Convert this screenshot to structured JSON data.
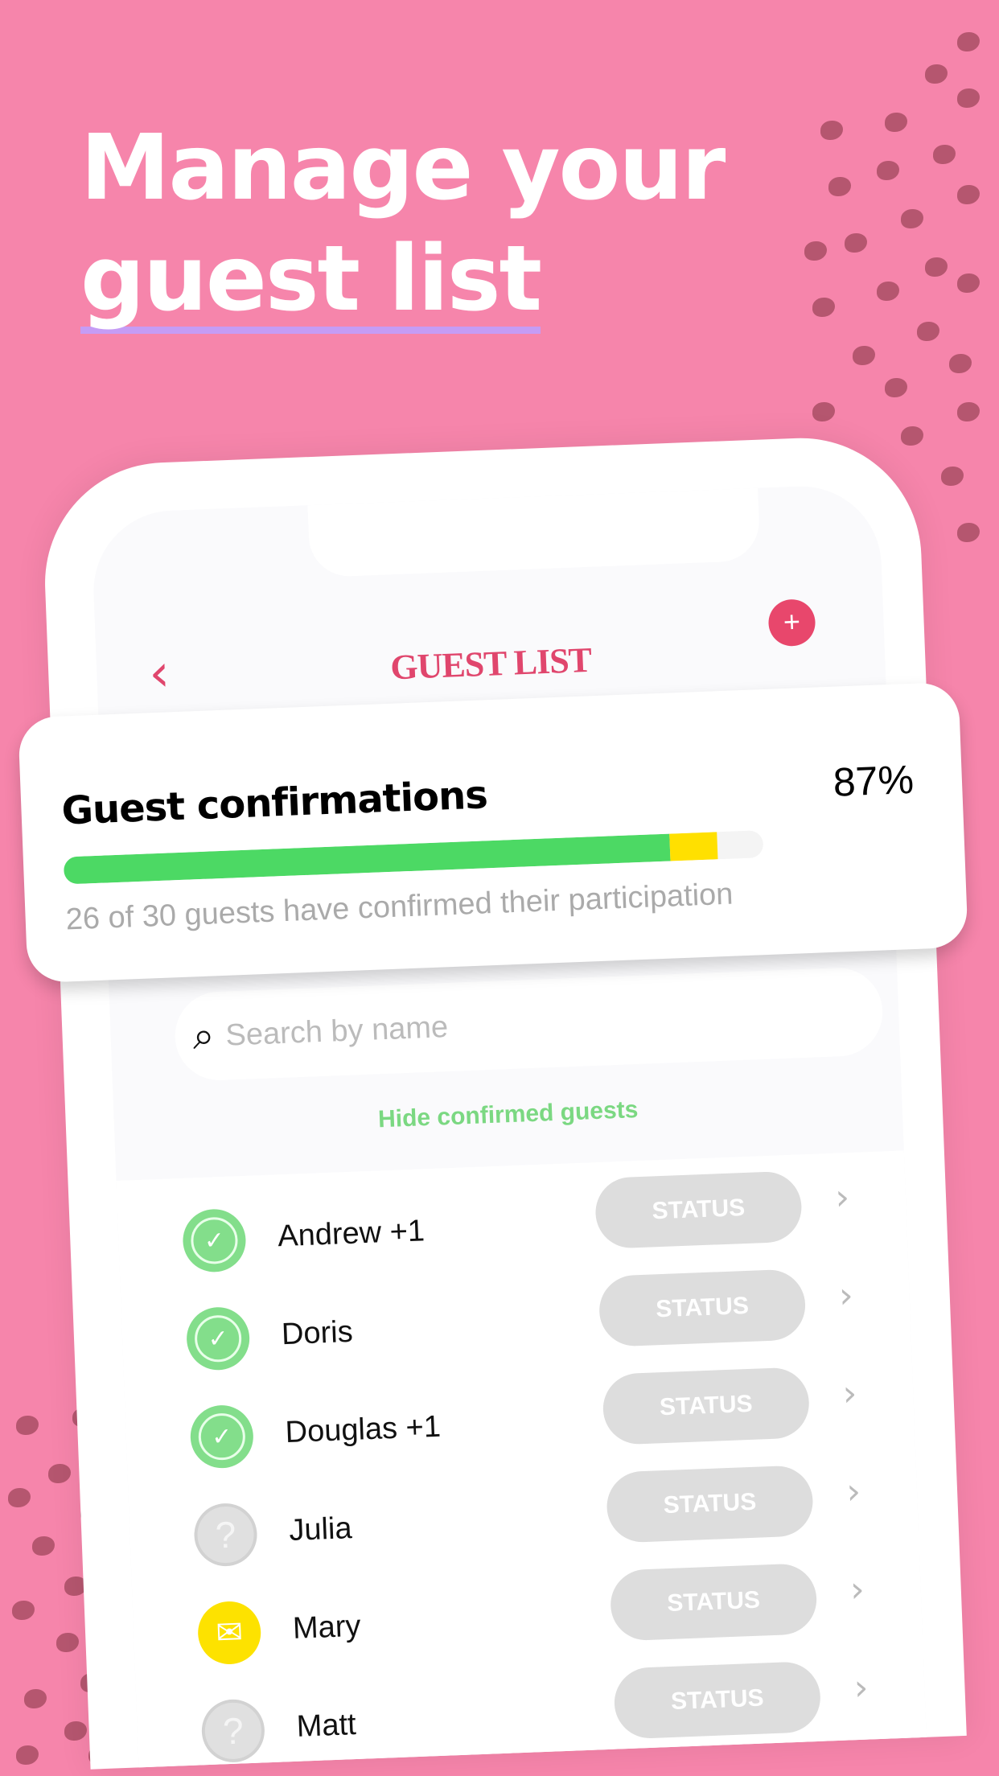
{
  "headline": {
    "line1": "Manage your",
    "line2": "guest list"
  },
  "header": {
    "title": "GUEST LIST",
    "back_icon": "chevron-left-icon",
    "add_icon": "plus-icon",
    "add_label": "+"
  },
  "confirmations": {
    "title": "Guest confirmations",
    "percent": "87%",
    "confirmed_fraction": 0.867,
    "pending_fraction": 0.067,
    "subtitle": "26 of 30 guests have confirmed their participation"
  },
  "search": {
    "placeholder": "Search by name",
    "icon": "search-icon"
  },
  "filter": {
    "hide_label": "Hide confirmed guests"
  },
  "guests": [
    {
      "name": "Andrew +1",
      "state": "confirmed",
      "status": "STATUS"
    },
    {
      "name": "Doris",
      "state": "confirmed",
      "status": "STATUS"
    },
    {
      "name": "Douglas +1",
      "state": "confirmed",
      "status": "STATUS"
    },
    {
      "name": "Julia",
      "state": "pending",
      "status": "STATUS"
    },
    {
      "name": "Mary",
      "state": "invited",
      "status": "STATUS"
    },
    {
      "name": "Matt",
      "state": "pending",
      "status": "STATUS"
    }
  ],
  "colors": {
    "background": "#f685ab",
    "accent": "#e0466d",
    "confirmed": "#4cd964",
    "pending": "#ffe000",
    "underline": "#c59cf5"
  }
}
